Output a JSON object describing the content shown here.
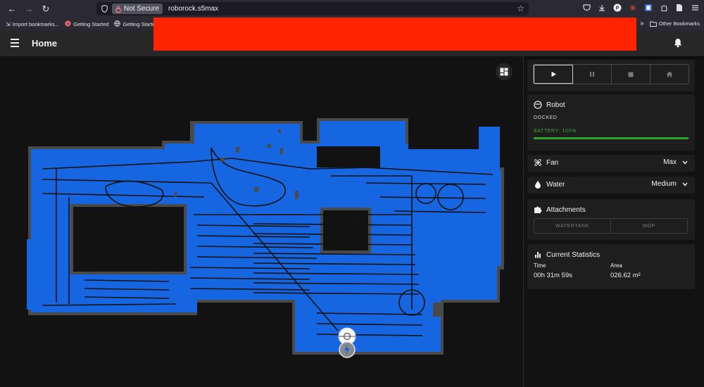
{
  "browser": {
    "url_security_label": "Not Secure",
    "url": "roborock.s5max",
    "bookmarks": [
      {
        "label": "Import bookmarks..."
      },
      {
        "label": "Getting Started"
      },
      {
        "label": "Getting Started"
      }
    ],
    "other_bookmarks": "Other Bookmarks"
  },
  "appbar": {
    "title": "Home"
  },
  "controls": {
    "buttons": [
      {
        "name": "start-button",
        "glyph": "▶"
      },
      {
        "name": "pause-button",
        "glyph": "❚❚"
      },
      {
        "name": "stop-button",
        "glyph": "■"
      },
      {
        "name": "home-button",
        "glyph": "⌂"
      }
    ]
  },
  "robot": {
    "title": "Robot",
    "status": "DOCKED",
    "battery_label": "BATTERY: 100%",
    "battery_level": 1.0
  },
  "fan": {
    "label": "Fan",
    "value": "Max"
  },
  "water": {
    "label": "Water",
    "value": "Medium"
  },
  "attachments": {
    "label": "Attachments",
    "items": [
      "WATERTANK",
      "MOP"
    ]
  },
  "statistics": {
    "title": "Current Statistics",
    "time_label": "Time",
    "time_value": "00h 31m 59s",
    "area_label": "Area",
    "area_value": "026.62 m²"
  },
  "colors": {
    "floor": "#1566e0",
    "wall": "#4a4a4a",
    "path": "#111111",
    "battery": "#2ea12e",
    "redaction": "#ff2400"
  }
}
